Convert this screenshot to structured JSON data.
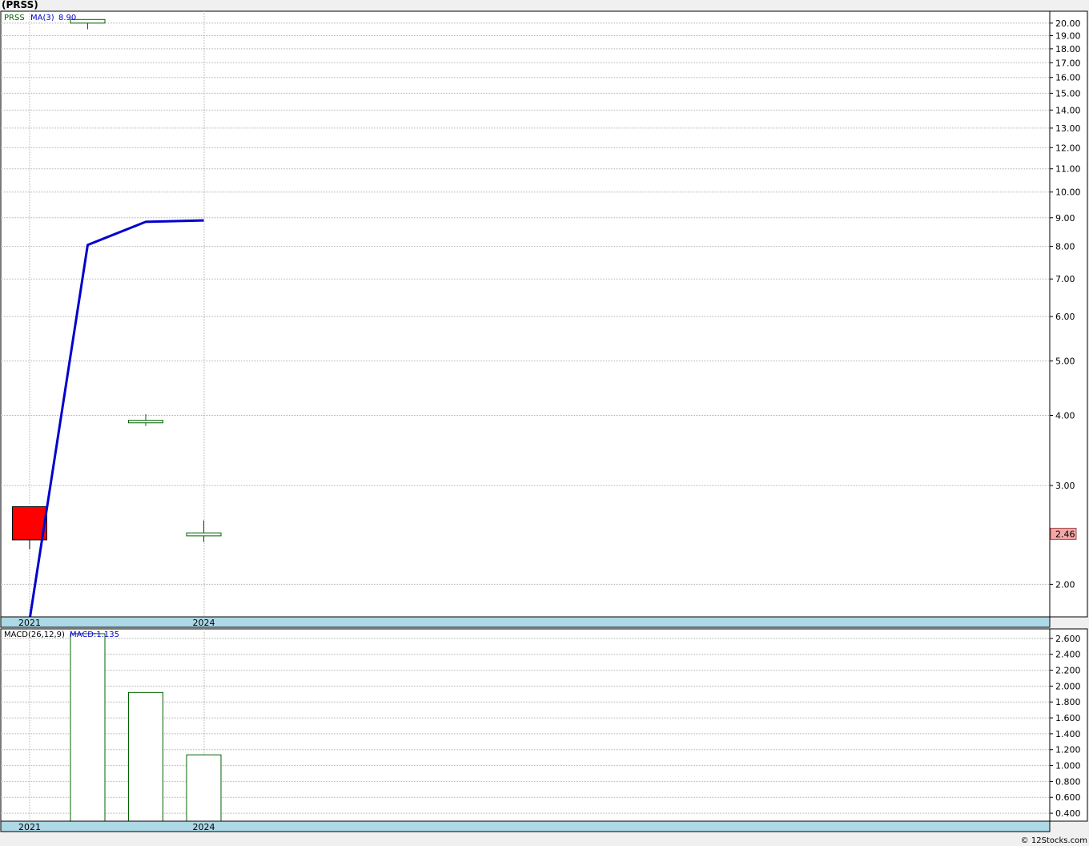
{
  "title": "(PRSS)",
  "footer": "© 12Stocks.com",
  "colors": {
    "background": "#ffffff",
    "page_background": "#f0f0f0",
    "grid": "#b4b4b4",
    "axis_band": "#add8e6",
    "up_candle": "#006400",
    "down_candle_fill": "#ff0000",
    "ma_line": "#0000cd",
    "last_price_fill": "#f4a6a6",
    "macd_bar": "#006400"
  },
  "chart_data": [
    {
      "type": "candlestick",
      "scale": "log",
      "legend": {
        "symbol": "PRSS",
        "ma_label": "MA(3)",
        "ma_value": "8.90"
      },
      "last_price_label": "2.46",
      "x_tick_labels": [
        {
          "label": "2021",
          "index": 0
        },
        {
          "label": "2024",
          "index": 3
        }
      ],
      "y_ticks": [
        {
          "value": 2,
          "label": "2.00"
        },
        {
          "value": 3,
          "label": "3.00"
        },
        {
          "value": 4,
          "label": "4.00"
        },
        {
          "value": 5,
          "label": "5.00"
        },
        {
          "value": 6,
          "label": "6.00"
        },
        {
          "value": 7,
          "label": "7.00"
        },
        {
          "value": 8,
          "label": "8.00"
        },
        {
          "value": 9,
          "label": "9.00"
        },
        {
          "value": 10,
          "label": "10.00"
        },
        {
          "value": 11,
          "label": "11.00"
        },
        {
          "value": 12,
          "label": "12.00"
        },
        {
          "value": 13,
          "label": "13.00"
        },
        {
          "value": 14,
          "label": "14.00"
        },
        {
          "value": 15,
          "label": "15.00"
        },
        {
          "value": 16,
          "label": "16.00"
        },
        {
          "value": 17,
          "label": "17.00"
        },
        {
          "value": 18,
          "label": "18.00"
        },
        {
          "value": 19,
          "label": "19.00"
        },
        {
          "value": 20,
          "label": "20.00"
        }
      ],
      "ylim": [
        1.75,
        21.0
      ],
      "candles": [
        {
          "index": 0,
          "open": 2.75,
          "close": 2.4,
          "high": 2.75,
          "low": 2.31
        },
        {
          "index": 1,
          "open": 20.0,
          "close": 20.3,
          "high": 20.3,
          "low": 19.5
        },
        {
          "index": 2,
          "open": 3.88,
          "close": 3.92,
          "high": 4.02,
          "low": 3.83
        },
        {
          "index": 3,
          "open": 2.44,
          "close": 2.47,
          "high": 2.6,
          "low": 2.38
        }
      ],
      "ma_series": {
        "name": "MA(3)",
        "points": [
          {
            "index": 0,
            "value": 1.73
          },
          {
            "index": 1,
            "value": 8.05
          },
          {
            "index": 2,
            "value": 8.85
          },
          {
            "index": 3,
            "value": 8.9
          }
        ]
      }
    },
    {
      "type": "bar",
      "legend": {
        "label": "MACD(26,12,9)",
        "macd_label": "MACD:1.135"
      },
      "x_tick_labels": [
        {
          "label": "2021",
          "index": 0
        },
        {
          "label": "2024",
          "index": 3
        }
      ],
      "y_ticks": [
        {
          "value": 0.4,
          "label": "0.400"
        },
        {
          "value": 0.6,
          "label": "0.600"
        },
        {
          "value": 0.8,
          "label": "0.800"
        },
        {
          "value": 1.0,
          "label": "1.000"
        },
        {
          "value": 1.2,
          "label": "1.200"
        },
        {
          "value": 1.4,
          "label": "1.400"
        },
        {
          "value": 1.6,
          "label": "1.600"
        },
        {
          "value": 1.8,
          "label": "1.800"
        },
        {
          "value": 2.0,
          "label": "2.000"
        },
        {
          "value": 2.2,
          "label": "2.200"
        },
        {
          "value": 2.4,
          "label": "2.400"
        },
        {
          "value": 2.6,
          "label": "2.600"
        }
      ],
      "ylim": [
        0.3,
        2.72
      ],
      "bars": [
        {
          "index": 1,
          "value": 2.66
        },
        {
          "index": 2,
          "value": 1.92
        },
        {
          "index": 3,
          "value": 1.135
        }
      ]
    }
  ]
}
